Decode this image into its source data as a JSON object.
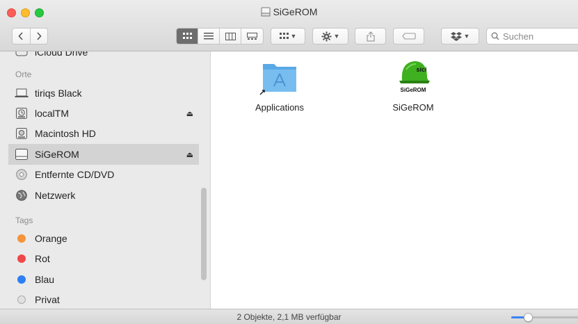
{
  "window": {
    "title": "SiGeROM"
  },
  "toolbar": {
    "back_icon": "chevron-left-icon",
    "forward_icon": "chevron-right-icon",
    "view_modes": [
      "icon-view",
      "list-view",
      "column-view",
      "gallery-view"
    ],
    "active_view": "icon-view",
    "search_placeholder": "Suchen"
  },
  "sidebar": {
    "partial_item": "iCloud Drive",
    "places_header": "Orte",
    "places": [
      {
        "label": "tiriqs Black",
        "icon": "laptop-icon",
        "eject": false
      },
      {
        "label": "localTM",
        "icon": "time-machine-icon",
        "eject": true
      },
      {
        "label": "Macintosh HD",
        "icon": "hard-drive-icon",
        "eject": false
      },
      {
        "label": "SiGeROM",
        "icon": "disk-image-icon",
        "eject": true,
        "selected": true
      },
      {
        "label": "Entfernte CD/DVD",
        "icon": "cd-icon",
        "eject": false
      },
      {
        "label": "Netzwerk",
        "icon": "network-globe-icon",
        "eject": false
      }
    ],
    "tags_header": "Tags",
    "tags": [
      {
        "label": "Orange",
        "color": "#f4953a"
      },
      {
        "label": "Rot",
        "color": "#f0474a"
      },
      {
        "label": "Blau",
        "color": "#2d7ff2"
      },
      {
        "label": "Privat",
        "color": "#d8d8d8"
      }
    ],
    "eject_glyph": "⏏"
  },
  "content": {
    "files": [
      {
        "name": "Applications",
        "icon": "applications-folder-alias-icon"
      },
      {
        "name": "SiGeROM",
        "icon": "sigerom-helmet-icon",
        "icon_text_top": "sici",
        "icon_text_bottom": "SiGeROM"
      }
    ]
  },
  "statusbar": {
    "text": "2 Objekte, 2,1 MB verfügbar",
    "zoom_level": 0.25
  }
}
